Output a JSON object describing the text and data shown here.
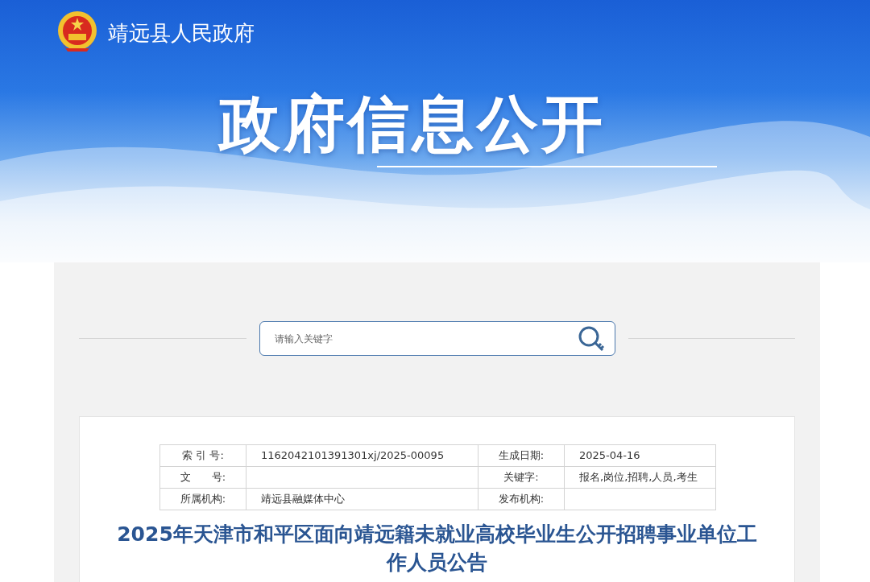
{
  "header": {
    "site_name": "靖远县人民政府",
    "banner_title": "政府信息公开"
  },
  "search": {
    "placeholder": "请输入关键字"
  },
  "info_table": {
    "rows": [
      {
        "cells": [
          {
            "label": "索 引 号:",
            "value": "1162042101391301xj/2025-00095"
          },
          {
            "label": "生成日期:",
            "value": "2025-04-16"
          }
        ]
      },
      {
        "cells": [
          {
            "label": "文　　号:"
          },
          {
            "label": "关键字:",
            "value": "报名,岗位,招聘,人员,考生"
          }
        ]
      },
      {
        "cells": [
          {
            "label": "所属机构:",
            "value": "靖远县融媒体中心"
          },
          {
            "label": "发布机构:"
          }
        ]
      }
    ]
  },
  "article": {
    "title": "2025年天津市和平区面向靖远籍未就业高校毕业生公开招聘事业单位工作人员公告"
  }
}
